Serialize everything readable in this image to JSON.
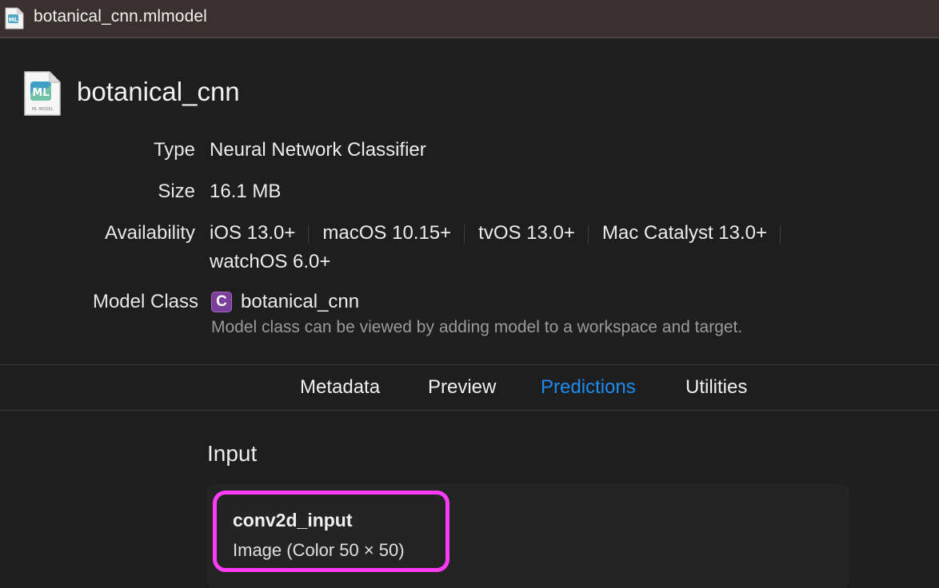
{
  "window": {
    "title": "botanical_cnn.mlmodel",
    "file_icon": "mlmodel-file-icon"
  },
  "model": {
    "name": "botanical_cnn",
    "icon_caption": "ML MODEL",
    "type_label": "Type",
    "type_value": "Neural Network Classifier",
    "size_label": "Size",
    "size_value": "16.1 MB",
    "availability_label": "Availability",
    "availability": [
      "iOS 13.0+",
      "macOS 10.15+",
      "tvOS 13.0+",
      "Mac Catalyst 13.0+",
      "watchOS 6.0+"
    ],
    "class_label": "Model Class",
    "class_badge": "C",
    "class_name": "botanical_cnn",
    "class_hint": "Model class can be viewed by adding model to a workspace and target."
  },
  "tabs": [
    {
      "label": "Metadata",
      "active": false
    },
    {
      "label": "Preview",
      "active": false
    },
    {
      "label": "Predictions",
      "active": true
    },
    {
      "label": "Utilities",
      "active": false
    }
  ],
  "predictions": {
    "section_title": "Input",
    "inputs": [
      {
        "name": "conv2d_input",
        "type": "Image (Color 50 × 50)"
      }
    ]
  },
  "colors": {
    "accent": "#1d8cf0",
    "highlight": "#ff3cf5",
    "class_badge": "#7a3f9a",
    "background": "#1e1e1e",
    "titlebar": "#3a302f"
  }
}
